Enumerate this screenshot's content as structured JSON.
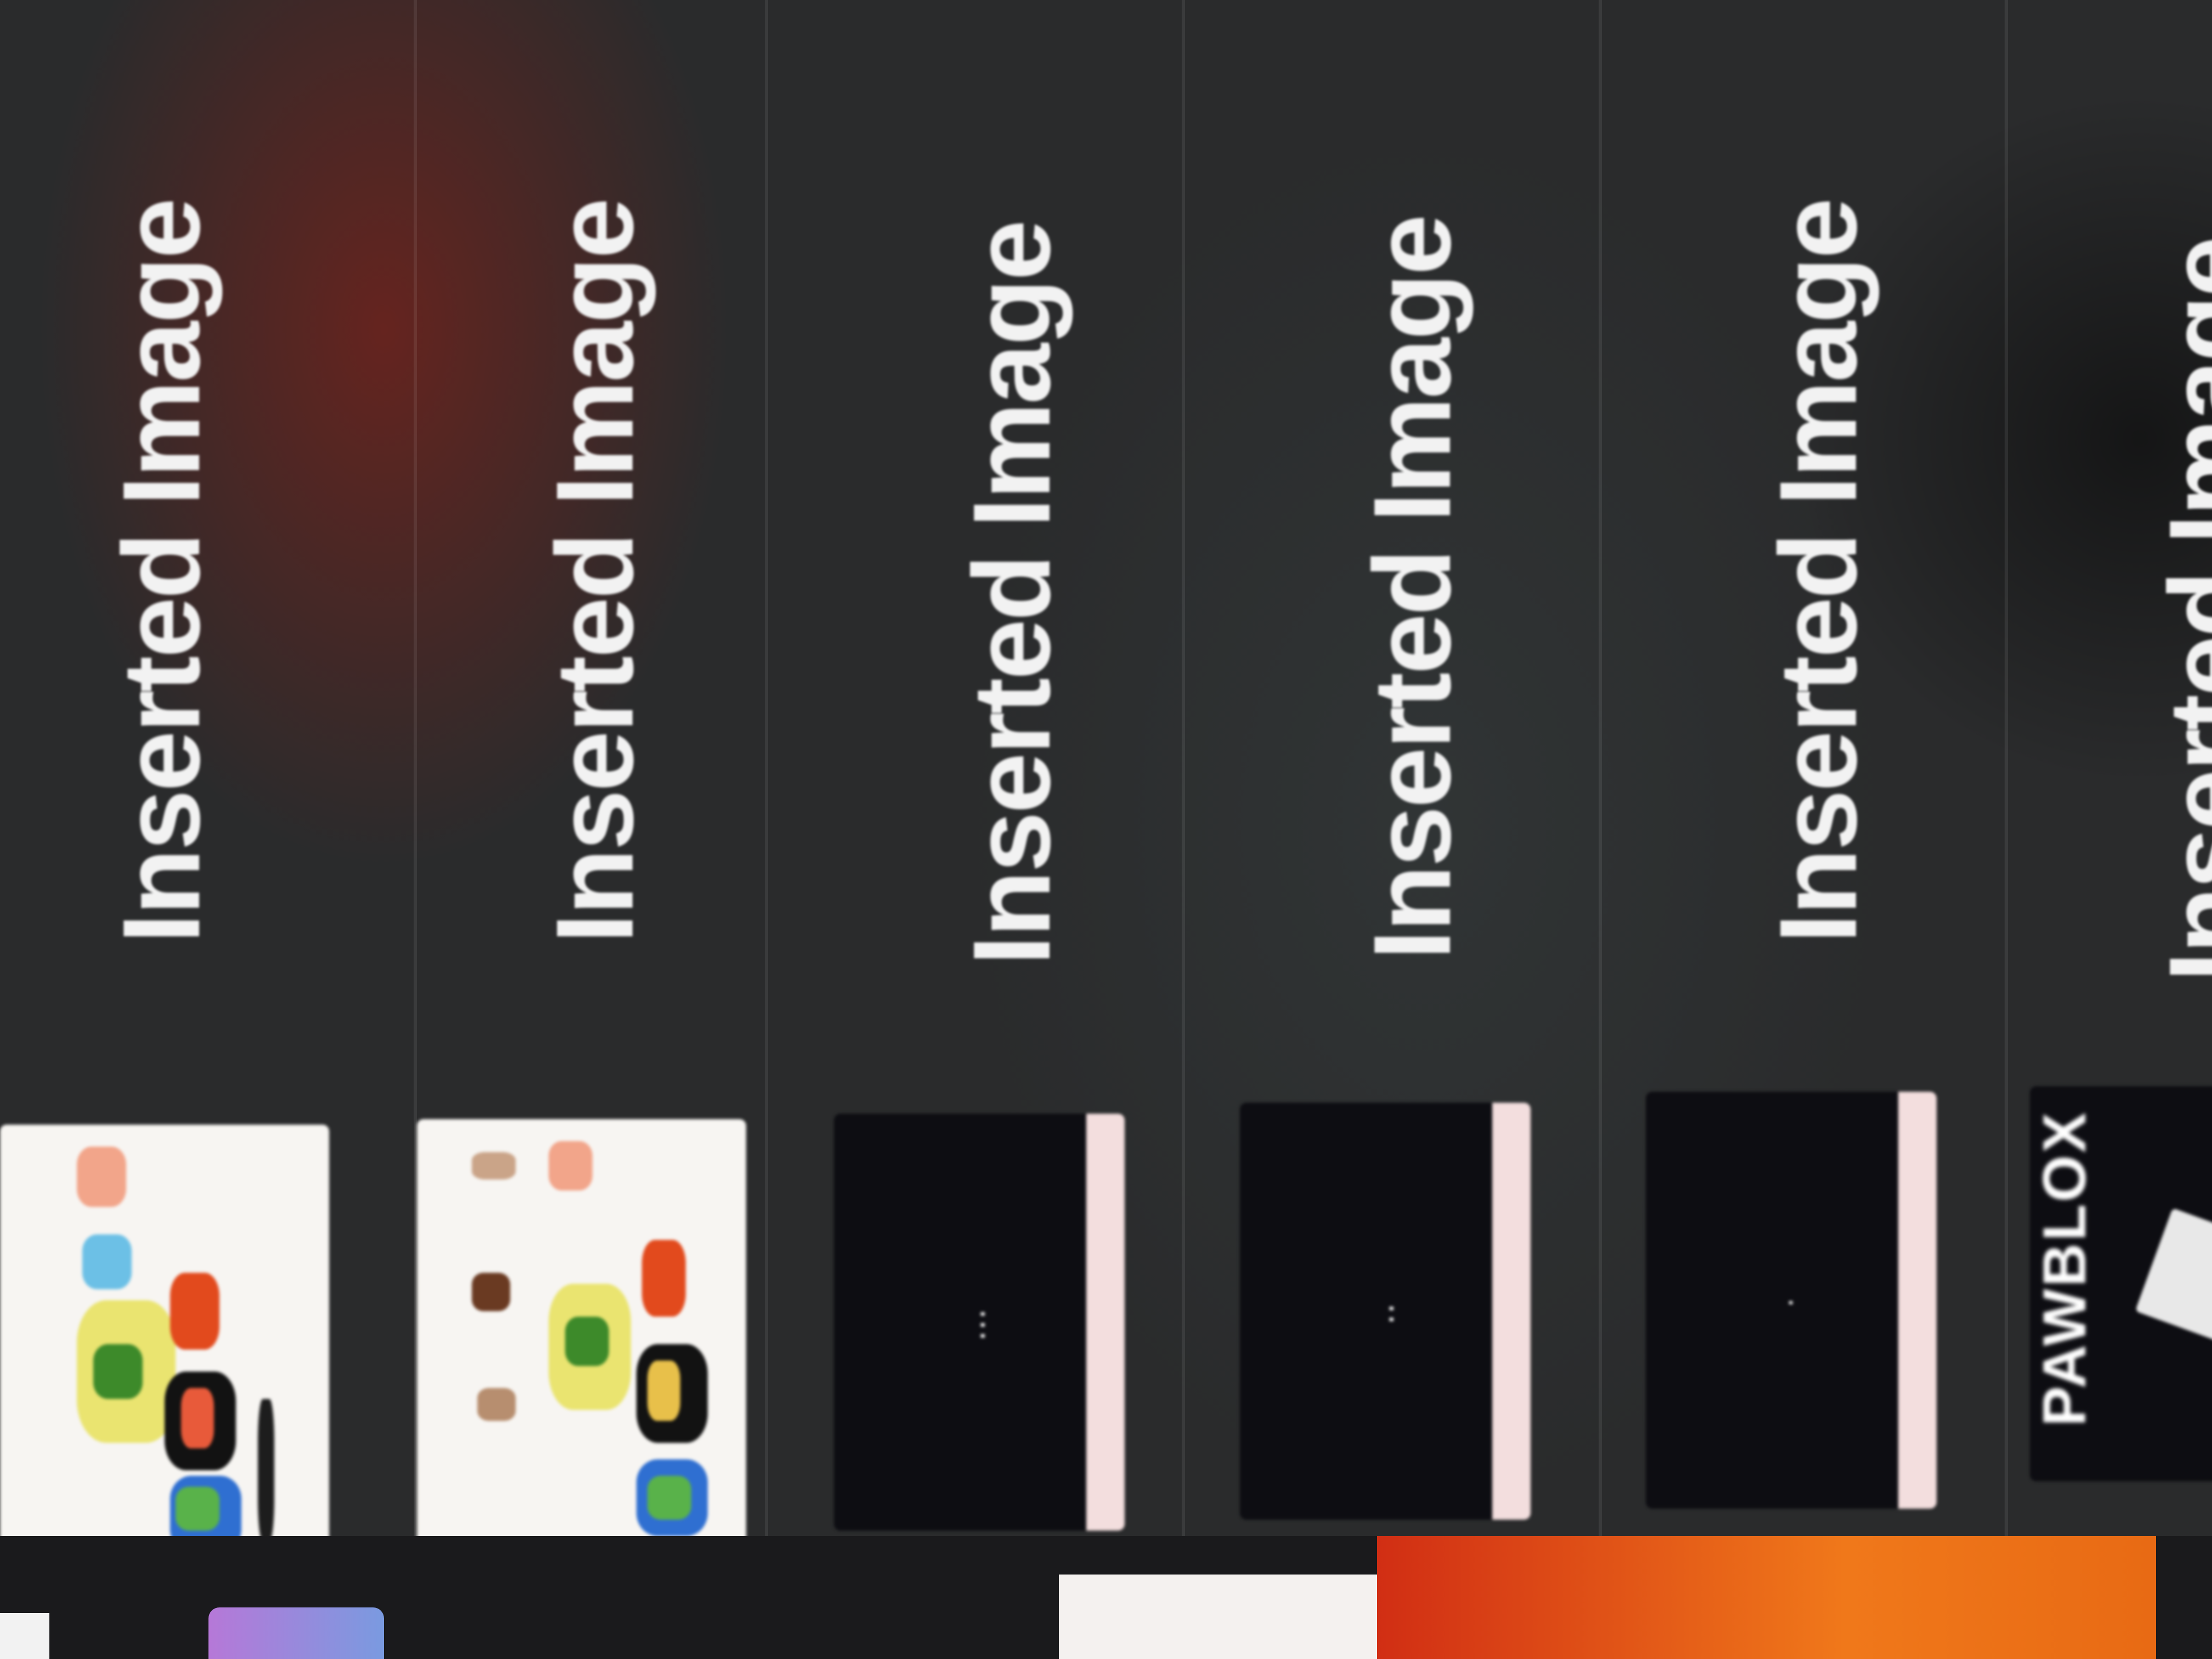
{
  "items": [
    {
      "label": "Inserted Image",
      "thumb": "collage-light"
    },
    {
      "label": "Inserted Image",
      "thumb": "collage-light"
    },
    {
      "label": "Inserted Image",
      "thumb": "dark"
    },
    {
      "label": "Inserted Image",
      "thumb": "dark"
    },
    {
      "label": "Inserted Image",
      "thumb": "dark"
    },
    {
      "label": "Inserted Image",
      "thumb": "logo",
      "logo_text": "PAWBLOX"
    }
  ],
  "colors": {
    "background": "#2a2b2c",
    "label": "#f2f2f2",
    "thumb_dark": "#0d0d12",
    "thumb_light": "#f7f5f2",
    "accent_red": "#d33a1a",
    "accent_orange": "#f07a18"
  }
}
